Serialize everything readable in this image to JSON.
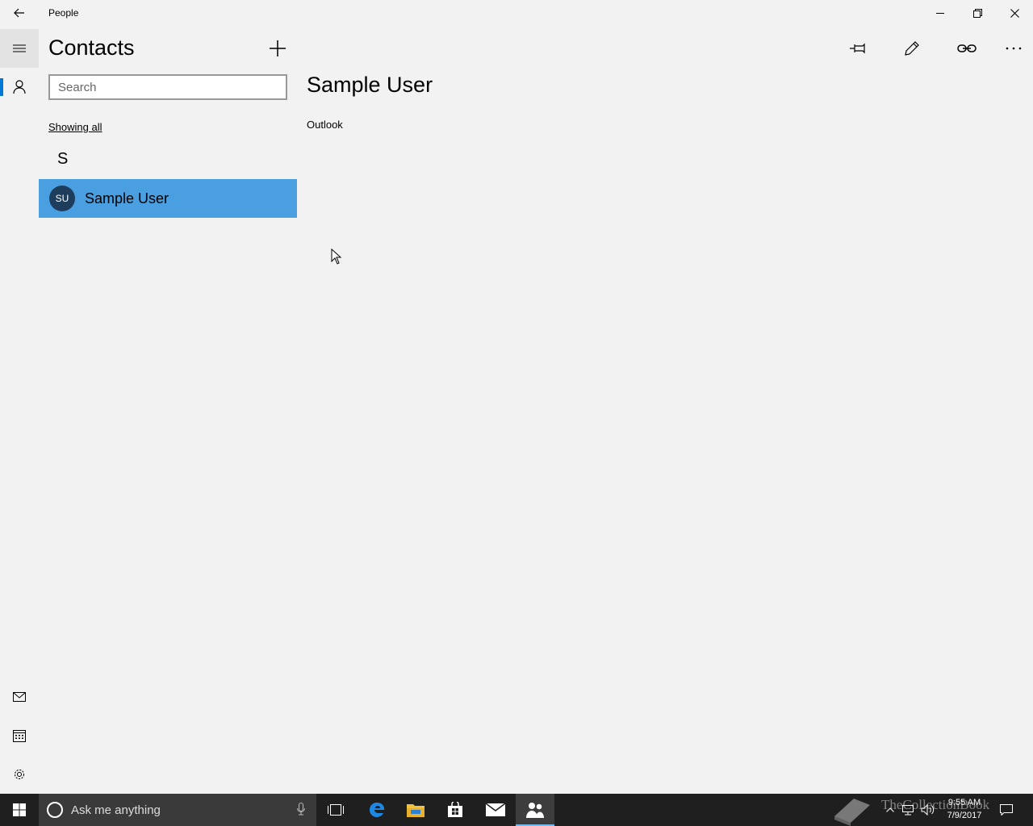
{
  "window": {
    "title": "People"
  },
  "contacts": {
    "header": "Contacts",
    "search_placeholder": "Search",
    "filter_label": "Showing all",
    "groups": [
      {
        "letter": "S",
        "items": [
          {
            "initials": "SU",
            "name": "Sample User",
            "selected": true
          }
        ]
      }
    ]
  },
  "detail": {
    "name": "Sample User",
    "source": "Outlook"
  },
  "colors": {
    "accent": "#0078d7",
    "selected_row": "#4a9fe0",
    "avatar_bg": "#1e3d5c",
    "taskbar": "#1f1f1f"
  },
  "taskbar": {
    "search_placeholder": "Ask me anything",
    "clock_time": "9:55 AM",
    "clock_date": "7/9/2017",
    "watermark": "TheCollectionBook"
  }
}
